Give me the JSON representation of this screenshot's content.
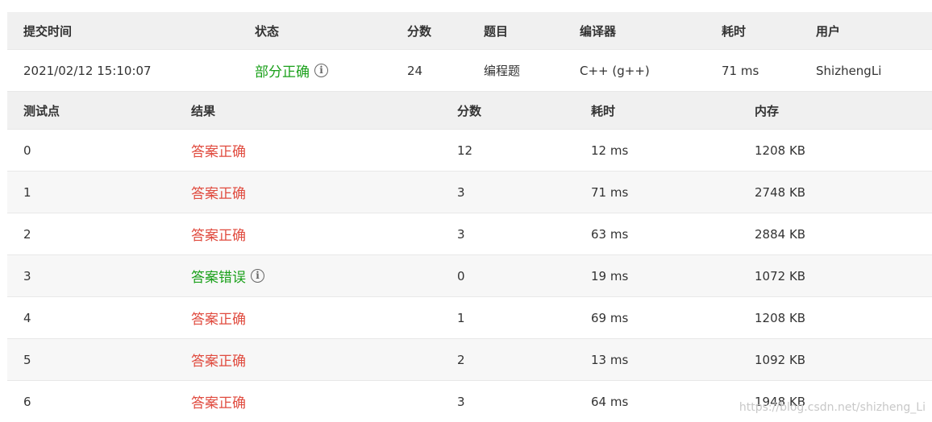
{
  "colors": {
    "correct": "#e04b3f",
    "partial": "#1aa01a",
    "wrong": "#1aa01a"
  },
  "submission": {
    "headers": [
      "提交时间",
      "状态",
      "分数",
      "题目",
      "编译器",
      "耗时",
      "用户"
    ],
    "row": {
      "time": "2021/02/12 15:10:07",
      "status": "部分正确",
      "score": "24",
      "problem": "编程题",
      "compiler": "C++ (g++)",
      "elapsed": "71 ms",
      "user": "ShizhengLi"
    }
  },
  "cases": {
    "headers": [
      "测试点",
      "结果",
      "分数",
      "耗时",
      "内存"
    ],
    "rows": [
      {
        "id": "0",
        "result": "答案正确",
        "result_kind": "correct",
        "score": "12",
        "time": "12 ms",
        "mem": "1208 KB"
      },
      {
        "id": "1",
        "result": "答案正确",
        "result_kind": "correct",
        "score": "3",
        "time": "71 ms",
        "mem": "2748 KB"
      },
      {
        "id": "2",
        "result": "答案正确",
        "result_kind": "correct",
        "score": "3",
        "time": "63 ms",
        "mem": "2884 KB"
      },
      {
        "id": "3",
        "result": "答案错误",
        "result_kind": "wrong",
        "score": "0",
        "time": "19 ms",
        "mem": "1072 KB"
      },
      {
        "id": "4",
        "result": "答案正确",
        "result_kind": "correct",
        "score": "1",
        "time": "69 ms",
        "mem": "1208 KB"
      },
      {
        "id": "5",
        "result": "答案正确",
        "result_kind": "correct",
        "score": "2",
        "time": "13 ms",
        "mem": "1092 KB"
      },
      {
        "id": "6",
        "result": "答案正确",
        "result_kind": "correct",
        "score": "3",
        "time": "64 ms",
        "mem": "1948 KB"
      }
    ]
  },
  "info_icon": "info-circle-icon",
  "watermark": "https://blog.csdn.net/shizheng_Li"
}
